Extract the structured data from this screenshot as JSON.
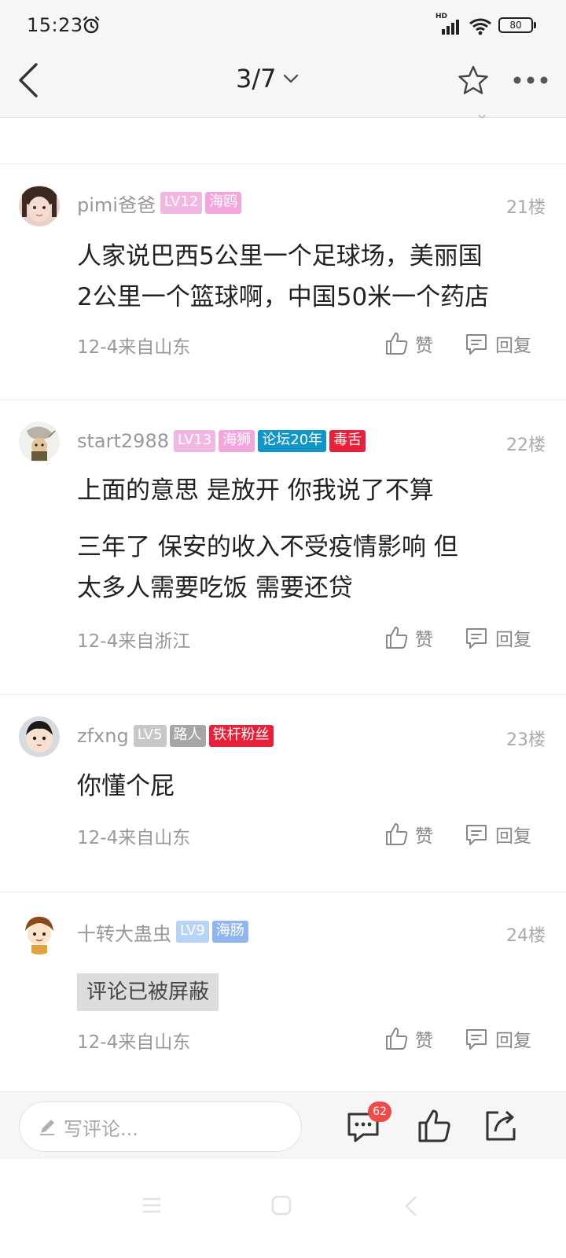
{
  "status_bar": {
    "time": "15:23",
    "network": "HD",
    "battery": "80"
  },
  "nav": {
    "page_indicator": "3/7"
  },
  "comments": [
    {
      "username": "pimi爸爸",
      "badges": [
        {
          "text": "LV12",
          "color": "#f2b6e3"
        },
        {
          "text": "海鸥",
          "color": "#f3a6dd"
        }
      ],
      "floor": "21楼",
      "lines": [
        "人家说巴西5公里一个足球场，美丽国",
        "2公里一个篮球啊，中国50米一个药店"
      ],
      "meta": "12-4来自山东",
      "like_label": "赞",
      "reply_label": "回复"
    },
    {
      "username": "start2988",
      "badges": [
        {
          "text": "LV13",
          "color": "#f2b6e3"
        },
        {
          "text": "海狮",
          "color": "#f3a6dd"
        },
        {
          "text": "论坛20年",
          "color": "#1296c8"
        },
        {
          "text": "毒舌",
          "color": "#e8203a"
        }
      ],
      "floor": "22楼",
      "paragraphs": [
        "上面的意思  是放开  你我说了不算",
        "三年了  保安的收入不受疫情影响  但",
        "太多人需要吃饭  需要还贷"
      ],
      "meta": "12-4来自浙江",
      "like_label": "赞",
      "reply_label": "回复"
    },
    {
      "username": "zfxng",
      "badges": [
        {
          "text": "LV5",
          "color": "#c8c8c8"
        },
        {
          "text": "路人",
          "color": "#a6a6a6"
        },
        {
          "text": "铁杆粉丝",
          "color": "#e8203a"
        }
      ],
      "floor": "23楼",
      "lines": [
        "你懂个屁"
      ],
      "meta": "12-4来自山东",
      "like_label": "赞",
      "reply_label": "回复"
    },
    {
      "username": "十转大蛊虫",
      "badges": [
        {
          "text": "LV9",
          "color": "#b9d3f6"
        },
        {
          "text": "海肠",
          "color": "#8fb6f0"
        }
      ],
      "floor": "24楼",
      "blocked_text": "评论已被屏蔽",
      "meta": "12-4来自山东",
      "like_label": "赞",
      "reply_label": "回复"
    }
  ],
  "bottom_bar": {
    "placeholder": "写评论...",
    "comment_count": "62"
  },
  "colors": {
    "accent_badge": "#f04a4a",
    "meta_gray": "#999999"
  }
}
